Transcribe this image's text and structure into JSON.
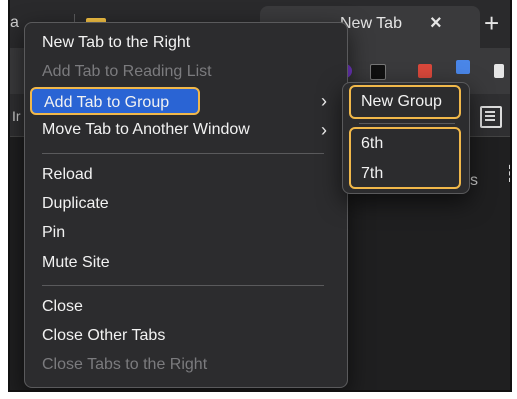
{
  "background": {
    "tab_fragment_left": "a",
    "active_tab_title": "New Tab",
    "active_tab_close": "×",
    "new_tab_symbol": "+",
    "bookmark_fragment": "Ir",
    "right_fragment": "s",
    "kebab": "⋮"
  },
  "context_menu": {
    "items": [
      {
        "label": "New Tab to the Right",
        "enabled": true
      },
      {
        "label": "Add Tab to Reading List",
        "enabled": false
      },
      {
        "label": "Add Tab to Group",
        "enabled": true,
        "submenu": true,
        "highlighted": true
      },
      {
        "label": "Move Tab to Another Window",
        "enabled": true,
        "submenu": true
      },
      {
        "label": "Reload",
        "enabled": true
      },
      {
        "label": "Duplicate",
        "enabled": true
      },
      {
        "label": "Pin",
        "enabled": true
      },
      {
        "label": "Mute Site",
        "enabled": true
      },
      {
        "label": "Close",
        "enabled": true
      },
      {
        "label": "Close Other Tabs",
        "enabled": true
      },
      {
        "label": "Close Tabs to the Right",
        "enabled": false
      }
    ],
    "submenu_chevron": "›"
  },
  "group_submenu": {
    "new_group": "New Group",
    "groups": [
      "6th",
      "7th"
    ]
  },
  "colors": {
    "menu_bg": "#2c2c2e",
    "highlight": "#2a64d4",
    "annotation_outline": "#f1b84a",
    "disabled_text": "#7b7b7e"
  }
}
